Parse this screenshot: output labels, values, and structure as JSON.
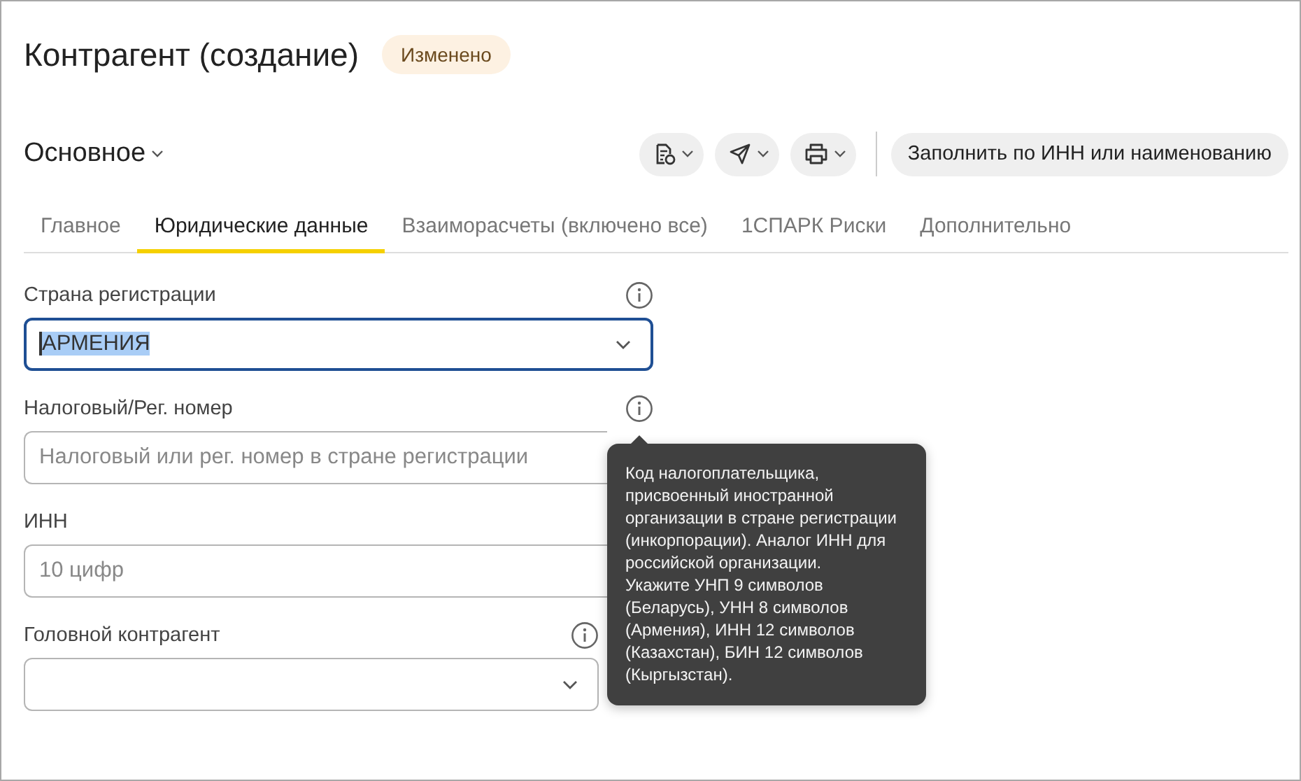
{
  "window": {
    "title": "Контрагент (создание)",
    "badge": "Изменено"
  },
  "toolbar": {
    "menu": "Основное",
    "icon_buttons": [
      {
        "kind": "report"
      },
      {
        "kind": "send"
      },
      {
        "kind": "print"
      }
    ],
    "fill_button": "Заполнить по ИНН или наименованию"
  },
  "tabs": [
    {
      "label": "Главное",
      "selected": false
    },
    {
      "label": "Юридические данные",
      "selected": true
    },
    {
      "label": "Взаиморасчеты (включено все)",
      "selected": false
    },
    {
      "label": "1СПАРК Риски",
      "selected": false
    },
    {
      "label": "Дополнительно",
      "selected": false
    }
  ],
  "fields": [
    {
      "label": "Страна регистрации",
      "kind": "select",
      "value": "АРМЕНИЯ",
      "focused": true,
      "info": true,
      "wide": true
    },
    {
      "label": "Налоговый/Рег. номер",
      "kind": "text",
      "placeholder": "Налоговый или рег. номер в стране регистрации",
      "focused": false,
      "info": true,
      "wide": true
    },
    {
      "label": "ИНН",
      "kind": "text",
      "placeholder": "10 цифр",
      "focused": false,
      "info": false,
      "wide": true
    },
    {
      "label": "Головной контрагент",
      "kind": "select",
      "focused": false,
      "info": true,
      "wide": false
    }
  ],
  "tooltip": {
    "lines": [
      "Код налогоплательщика,",
      "присвоенный иностранной",
      "организации в стране регистрации",
      "(инкорпорации). Аналог ИНН для",
      "российской организации.",
      "Укажите УНП 9 символов",
      "(Беларусь), УНН 8 символов",
      "(Армения), ИНН 12 символов",
      "(Казахстан), БИН 12 символов",
      "(Кыргызстан)."
    ]
  }
}
